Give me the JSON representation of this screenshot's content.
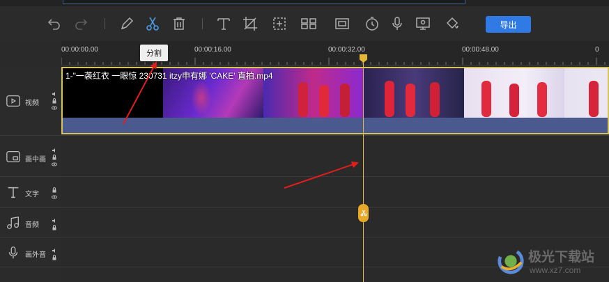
{
  "toolbar": {
    "undo": "undo-icon",
    "redo": "redo-icon",
    "edit": "pencil-icon",
    "split": "scissors-icon",
    "delete": "trash-icon",
    "text": "text-icon",
    "crop": "crop-icon",
    "mosaic": "mosaic-icon",
    "split_screen": "split-screen-icon",
    "aspect": "aspect-ratio-icon",
    "speed": "speed-icon",
    "voiceover": "microphone-icon",
    "record": "screen-record-icon",
    "fill": "paint-bucket-icon",
    "export_label": "导出",
    "accent": "#2f7ae5",
    "split_active_color": "#4a9de8"
  },
  "tooltip": {
    "label": "分割"
  },
  "ruler": {
    "labels": [
      "00:00:00.00",
      "00:00:16.00",
      "00:00:32.00",
      "00:00:48.00",
      "0"
    ]
  },
  "tracks": [
    {
      "label": "视频",
      "icon": "video-track-icon"
    },
    {
      "label": "画中画",
      "icon": "pip-track-icon"
    },
    {
      "label": "文字",
      "icon": "text-track-icon"
    },
    {
      "label": "音频",
      "icon": "music-track-icon"
    },
    {
      "label": "画外音",
      "icon": "mic-track-icon"
    }
  ],
  "clip": {
    "title": "1-\"一袭红衣 一眼惊 230731 itzy申有娜 'CAKE' 直拍.mp4",
    "border_color": "#d7c35d"
  },
  "playhead": {
    "color": "#e3b63a"
  },
  "watermark": {
    "name": "极光下载站",
    "url": "www.xz7.com"
  }
}
